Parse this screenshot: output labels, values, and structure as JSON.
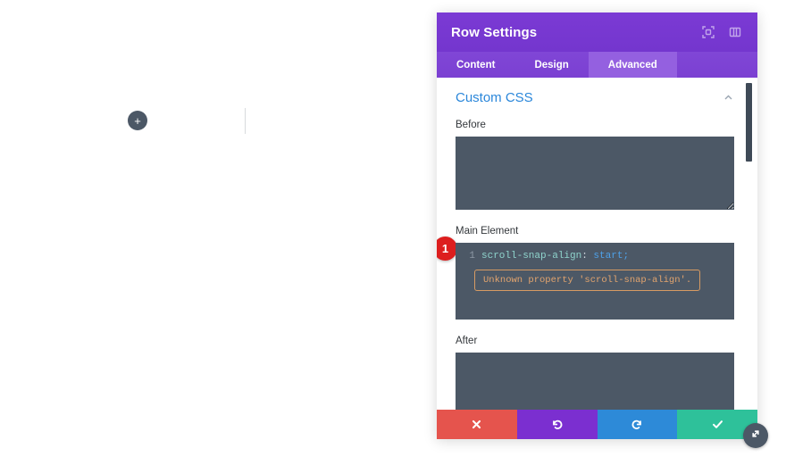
{
  "canvas": {
    "add_row_label": "+",
    "add_row_icon": "plus-icon",
    "divider_name": "column-divider"
  },
  "panel": {
    "title": "Row Settings",
    "header_icons": [
      {
        "name": "fullscreen-icon"
      },
      {
        "name": "layout-columns-icon"
      }
    ],
    "tabs": [
      {
        "label": "Content",
        "active": false
      },
      {
        "label": "Design",
        "active": false
      },
      {
        "label": "Advanced",
        "active": true
      }
    ],
    "section": {
      "title": "Custom CSS",
      "collapse_icon": "chevron-up-icon",
      "expanded": true
    },
    "fields": [
      {
        "label": "Before",
        "value": ""
      },
      {
        "label": "Main Element"
      },
      {
        "label": "After",
        "value": ""
      }
    ],
    "code_editor": {
      "line_number": "1",
      "property": "scroll-snap-align",
      "separator": ": ",
      "value": "start",
      "terminator": ";",
      "error": {
        "badge": "1",
        "message": "Unknown property 'scroll-snap-align'.",
        "border_color": "#d79b63",
        "text_color": "#e2a46e"
      }
    },
    "footer_buttons": [
      {
        "name": "cancel-button",
        "icon": "x-icon",
        "color": "#e5544d"
      },
      {
        "name": "undo-button",
        "icon": "undo-icon",
        "color": "#7b2fd0"
      },
      {
        "name": "redo-button",
        "icon": "redo-icon",
        "color": "#2d8ad8"
      },
      {
        "name": "save-button",
        "icon": "check-icon",
        "color": "#2ec19a"
      }
    ],
    "resize_handle_icon": "resize-diagonal-icon"
  },
  "colors": {
    "header_purple": "#7b3ad4",
    "tab_purple": "#8046d6",
    "tab_active_purple": "#9460e0",
    "section_title_blue": "#2b87da",
    "textarea_slate": "#4c5866",
    "badge_red": "#dd1e1e"
  }
}
